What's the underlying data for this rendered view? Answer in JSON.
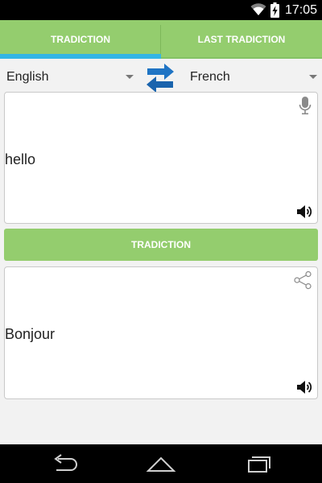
{
  "status_bar": {
    "time": "17:05",
    "icons": [
      "wifi-icon",
      "battery-charging-icon"
    ]
  },
  "tabs": [
    {
      "label": "TRADICTION",
      "selected": true
    },
    {
      "label": "LAST TRADICTION",
      "selected": false
    }
  ],
  "languages": {
    "source": "English",
    "target": "French",
    "swap_icon": "swap-arrows-icon"
  },
  "input": {
    "text": "hello",
    "icons": [
      "microphone-icon",
      "speaker-icon"
    ]
  },
  "translate_button": {
    "label": "TRADICTION"
  },
  "output": {
    "text": "Bonjour",
    "icons": [
      "share-icon",
      "speaker-icon"
    ]
  },
  "nav_bar": {
    "icons": [
      "back-icon",
      "home-icon",
      "recents-icon"
    ]
  },
  "colors": {
    "primary_green": "#94cd6e",
    "tab_indicator": "#33b5e5",
    "swap_blue": "#1f74c4",
    "background": "#f2f2f2"
  }
}
